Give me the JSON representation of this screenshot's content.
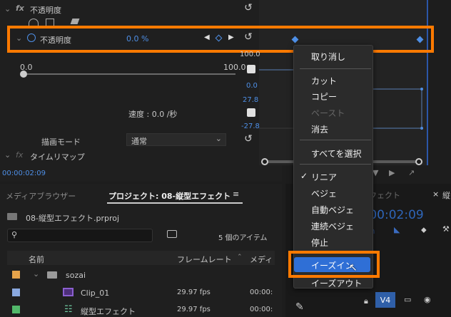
{
  "effect_controls": {
    "section_header": "不透明度",
    "opacity_row_label": "不透明度",
    "opacity_value": "0.0 %",
    "slider_min": "0.0",
    "slider_max": "100.0",
    "graph_top_value": "100.0",
    "graph_blue_value_1": "0.0",
    "graph_blue_value_2": "27.8",
    "graph_blue_value_3": "-27.8",
    "velocity_label": "速度 : 0.0 /秒",
    "blend_mode_label": "描画モード",
    "blend_mode_value": "通常",
    "time_remap_label": "タイムリマップ",
    "fx_label": "fx",
    "timecode": "00:00:02:09"
  },
  "context_menu": {
    "items": [
      "取り消し",
      "カット",
      "コピー",
      "ペースト",
      "消去",
      "すべてを選択",
      "リニア",
      "ベジェ",
      "自動ベジェ",
      "連続ベジェ",
      "停止",
      "イーズイン",
      "イーズアウト"
    ],
    "disabled_item": "ペースト",
    "checked_item": "リニア",
    "checkmark": "✓",
    "highlighted_item": "イーズイン"
  },
  "project_panel": {
    "tab_media_browser": "メディアブラウザー",
    "tab_project": "プロジェクト: 08-縦型エフェクト",
    "project_file": "08-縦型エフェクト.prproj",
    "item_count": "5 個のアイテム",
    "col_name": "名前",
    "col_framerate": "フレームレート",
    "col_media": "メディ",
    "rows": [
      {
        "name": "sozai",
        "fps": "",
        "media": ""
      },
      {
        "name": "Clip_01",
        "fps": "29.97 fps",
        "media": "00:00:"
      },
      {
        "name": "縦型エフェクト",
        "fps": "29.97 fps",
        "media": "00:00:"
      }
    ]
  },
  "timeline_panel": {
    "tab_label": "縦型エフェクト",
    "timecode": "00:00:02:09",
    "track_label": "V4"
  },
  "colors": {
    "highlight_orange": "#ff7a00",
    "accent_blue": "#4e8fe6",
    "menu_highlight": "#2f6fd6"
  }
}
